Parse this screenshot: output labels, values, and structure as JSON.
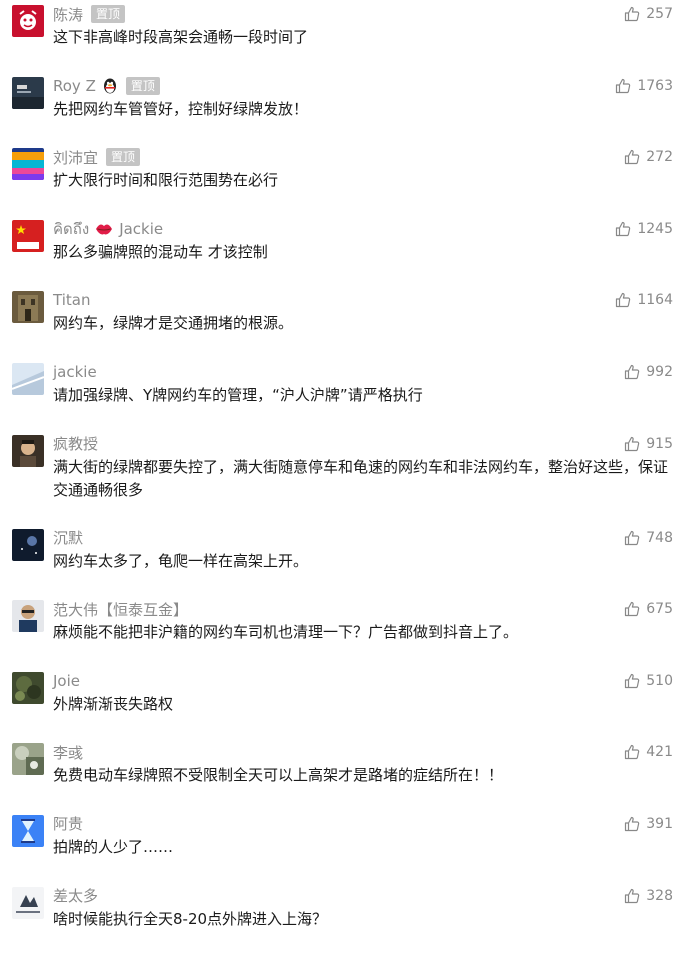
{
  "comments": [
    {
      "name": "陈涛",
      "pinned": true,
      "pin_label": "置顶",
      "likes": "257",
      "text": "这下非高峰时段高架会通畅一段时间了"
    },
    {
      "name": "Roy Z",
      "pinned": true,
      "pin_label": "置顶",
      "likes": "1763",
      "text": "先把网约车管管好，控制好绿牌发放！"
    },
    {
      "name": "刘沛宜",
      "pinned": true,
      "pin_label": "置顶",
      "likes": "272",
      "text": "扩大限行时间和限行范围势在必行"
    },
    {
      "name": "คิดถึง",
      "name2": "Jackie",
      "likes": "1245",
      "text": "那么多骗牌照的混动车 才该控制"
    },
    {
      "name": "Titan",
      "likes": "1164",
      "text": "网约车，绿牌才是交通拥堵的根源。"
    },
    {
      "name": "jackie",
      "likes": "992",
      "text": "请加强绿牌、Y牌网约车的管理，“沪人沪牌”请严格执行"
    },
    {
      "name": "疯教授",
      "likes": "915",
      "text": "满大街的绿牌都要失控了，满大街随意停车和龟速的网约车和非法网约车，整治好这些，保证交通通畅很多"
    },
    {
      "name": "沉默",
      "likes": "748",
      "text": "网约车太多了，龟爬一样在高架上开。"
    },
    {
      "name": "范大伟【恒泰互金】",
      "likes": "675",
      "text": "麻烦能不能把非沪籍的网约车司机也清理一下？广告都做到抖音上了。"
    },
    {
      "name": "Joie",
      "likes": "510",
      "text": "外牌渐渐丧失路权"
    },
    {
      "name": "李彧",
      "likes": "421",
      "text": "免费电动车绿牌照不受限制全天可以上高架才是路堵的症结所在！！"
    },
    {
      "name": "阿贵",
      "likes": "391",
      "text": "拍牌的人少了……"
    },
    {
      "name": "差太多",
      "likes": "328",
      "text": "啥时候能执行全天8-20点外牌进入上海？"
    }
  ],
  "avatar_lettering": {
    "avatar_4": "中国国旗"
  },
  "colors": {
    "name": "#8a8a8a",
    "text": "#1a1a1a",
    "pin_bg": "#c4c4c4",
    "likes": "#8a8a8a"
  }
}
